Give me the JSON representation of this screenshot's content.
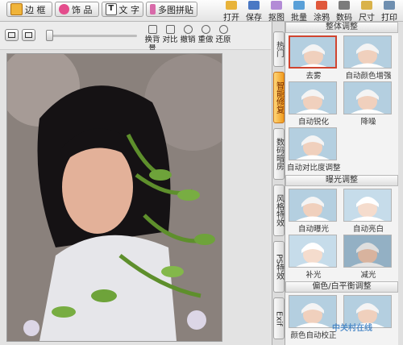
{
  "top_buttons": [
    {
      "label": "边 框"
    },
    {
      "label": "饰 品"
    },
    {
      "label": "文 字"
    },
    {
      "label": "多图拼贴"
    }
  ],
  "right_tools": [
    {
      "label": "打开"
    },
    {
      "label": "保存"
    },
    {
      "label": "抠图"
    },
    {
      "label": "批量"
    },
    {
      "label": "涂鸦"
    },
    {
      "label": "数码"
    },
    {
      "label": "尺寸"
    },
    {
      "label": "打印"
    }
  ],
  "view_tools": [
    {
      "label": "换背景"
    },
    {
      "label": "对比"
    },
    {
      "label": "撤销"
    },
    {
      "label": "重做"
    },
    {
      "label": "还原"
    }
  ],
  "zoom_percent": 0,
  "side_tabs": [
    {
      "label": "热门"
    },
    {
      "label": "智能修复"
    },
    {
      "label": "数码暗房"
    },
    {
      "label": "风格特效"
    },
    {
      "label": "PS特效"
    },
    {
      "label": "Exif"
    }
  ],
  "sections": {
    "whole": {
      "title": "整体调整",
      "items": [
        "去雾",
        "自动颜色增强",
        "自动锐化",
        "降噪",
        "自动对比度调整"
      ]
    },
    "exposure": {
      "title": "曝光调整",
      "items": [
        "自动曝光",
        "自动亮白",
        "补光",
        "减光"
      ]
    },
    "color": {
      "title": "偏色/白平衡调整",
      "items": [
        "颜色自动校正",
        ""
      ]
    }
  },
  "watermark_text": "中关村在线"
}
